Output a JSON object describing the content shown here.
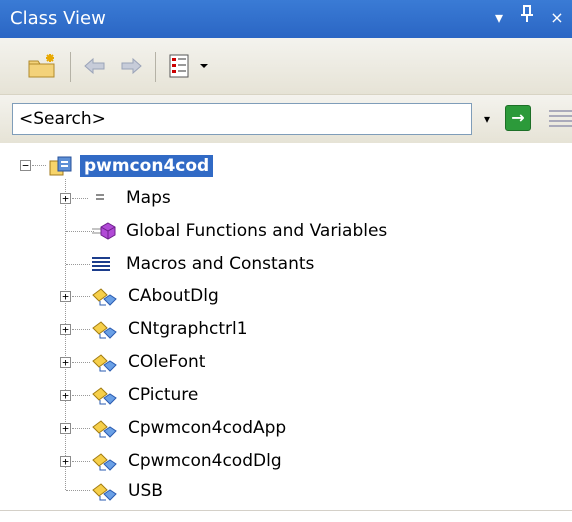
{
  "window": {
    "title": "Class View"
  },
  "titlebar": {
    "dropdown_glyph": "▾",
    "pin_glyph": "ᚆ",
    "close_glyph": "×"
  },
  "toolbar": {
    "icons": [
      "new-folder-icon",
      "back-arrow-icon",
      "forward-arrow-icon",
      "view-settings-icon",
      "dropdown-arrow-icon"
    ]
  },
  "search": {
    "value": "<Search>",
    "dropdown_glyph": "▾",
    "go_glyph": "→"
  },
  "tree": {
    "root": {
      "label": "pwmcon4cod",
      "expander": "−"
    },
    "items": [
      {
        "label": "Maps",
        "expander": "+",
        "icon": "maps-icon"
      },
      {
        "label": "Global Functions and Variables",
        "expander": "",
        "icon": "global-functions-icon"
      },
      {
        "label": "Macros and Constants",
        "expander": "",
        "icon": "macros-icon"
      },
      {
        "label": "CAboutDlg",
        "expander": "+",
        "icon": "class-icon"
      },
      {
        "label": "CNtgraphctrl1",
        "expander": "+",
        "icon": "class-icon"
      },
      {
        "label": "COleFont",
        "expander": "+",
        "icon": "class-icon"
      },
      {
        "label": "CPicture",
        "expander": "+",
        "icon": "class-icon"
      },
      {
        "label": "Cpwmcon4codApp",
        "expander": "+",
        "icon": "class-icon"
      },
      {
        "label": "Cpwmcon4codDlg",
        "expander": "+",
        "icon": "class-icon"
      },
      {
        "label": "USB",
        "expander": "",
        "icon": "class-icon"
      }
    ]
  },
  "colors": {
    "title_bar": "#2b66c4",
    "selection": "#316ac5",
    "go_button": "#2c9a3a"
  }
}
